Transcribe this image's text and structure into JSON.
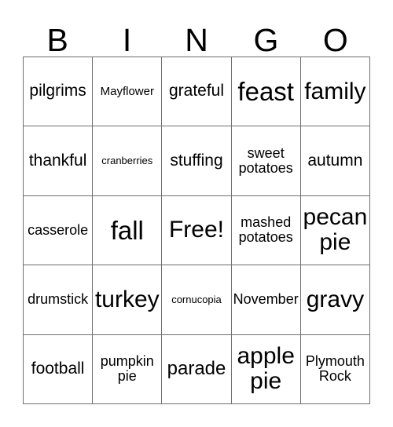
{
  "card": {
    "header_letters": [
      "B",
      "I",
      "N",
      "G",
      "O"
    ],
    "free_space_label": "Free!",
    "grid_border_color": "#6e6e6e",
    "text_color": "#000000",
    "background_color": "#ffffff",
    "rows": [
      [
        {
          "text": "pilgrims",
          "size": "lg"
        },
        {
          "text": "Mayflower",
          "size": "sm"
        },
        {
          "text": "grateful",
          "size": "lg"
        },
        {
          "text": "feast",
          "size": "huge"
        },
        {
          "text": "family",
          "size": "xxl"
        }
      ],
      [
        {
          "text": "thankful",
          "size": "lg"
        },
        {
          "text": "cranberries",
          "size": "xs"
        },
        {
          "text": "stuffing",
          "size": "lg"
        },
        {
          "text": "sweet\npotatoes",
          "size": "md"
        },
        {
          "text": "autumn",
          "size": "lg"
        }
      ],
      [
        {
          "text": "casserole",
          "size": "md"
        },
        {
          "text": "fall",
          "size": "huge"
        },
        {
          "text": "Free!",
          "size": "xxl"
        },
        {
          "text": "mashed\npotatoes",
          "size": "md"
        },
        {
          "text": "pecan\npie",
          "size": "xxl"
        }
      ],
      [
        {
          "text": "drumstick",
          "size": "md"
        },
        {
          "text": "turkey",
          "size": "xxl"
        },
        {
          "text": "cornucopia",
          "size": "xs"
        },
        {
          "text": "November",
          "size": "md"
        },
        {
          "text": "gravy",
          "size": "xxl"
        }
      ],
      [
        {
          "text": "football",
          "size": "lg"
        },
        {
          "text": "pumpkin\npie",
          "size": "md"
        },
        {
          "text": "parade",
          "size": "xl"
        },
        {
          "text": "apple\npie",
          "size": "xxl"
        },
        {
          "text": "Plymouth\nRock",
          "size": "md"
        }
      ]
    ]
  }
}
